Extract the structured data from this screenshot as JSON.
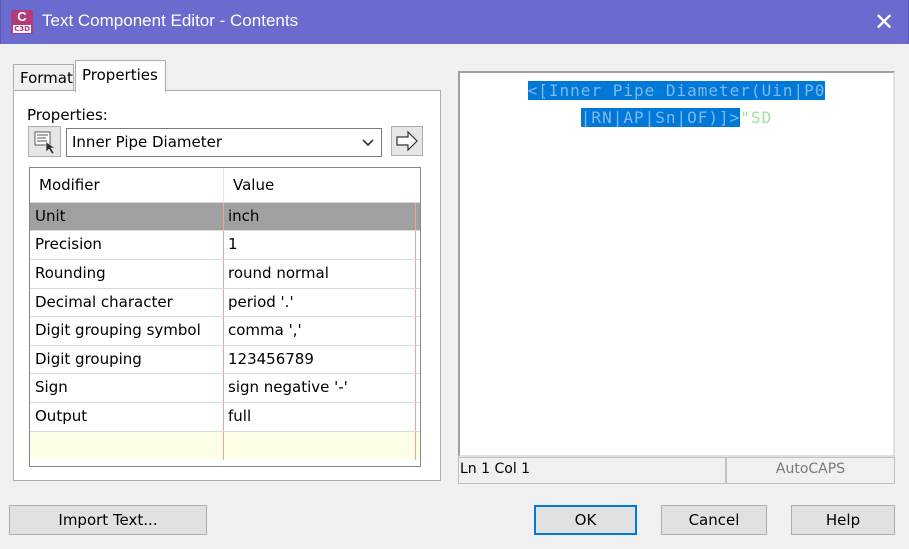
{
  "window": {
    "title": "Text Component Editor - Contents",
    "icon_text_top": "C",
    "icon_text_bottom": "C3D",
    "close_glyph": "✕"
  },
  "tabs": [
    {
      "label": "Format",
      "active": false
    },
    {
      "label": "Properties",
      "active": true
    }
  ],
  "properties_panel": {
    "label": "Properties:",
    "selected_property": "Inner Pipe Diameter"
  },
  "grid": {
    "columns": [
      "Modifier",
      "Value"
    ],
    "rows": [
      {
        "modifier": "Unit",
        "value": "inch",
        "selected": true
      },
      {
        "modifier": "Precision",
        "value": "1"
      },
      {
        "modifier": "Rounding",
        "value": "round normal"
      },
      {
        "modifier": "Decimal character",
        "value": "period '.'"
      },
      {
        "modifier": "Digit grouping symbol",
        "value": "comma ','"
      },
      {
        "modifier": "Digit grouping",
        "value": "123456789"
      },
      {
        "modifier": "Sign",
        "value": "sign negative '-'"
      },
      {
        "modifier": "Output",
        "value": "full"
      }
    ]
  },
  "editor": {
    "line1": "<[Inner Pipe Diameter(Uin|P0",
    "line2_selected": "|RN|AP|Sn|OF)]>",
    "line2_tail": "\"SD"
  },
  "status": {
    "position": "Ln 1 Col 1",
    "caps": "AutoCAPS"
  },
  "buttons": {
    "import": "Import Text...",
    "ok": "OK",
    "cancel": "Cancel",
    "help": "Help"
  },
  "colors": {
    "titlebar": "#6b6bcf",
    "selection": "#0078d7",
    "selected_row": "#a0a0a0"
  }
}
